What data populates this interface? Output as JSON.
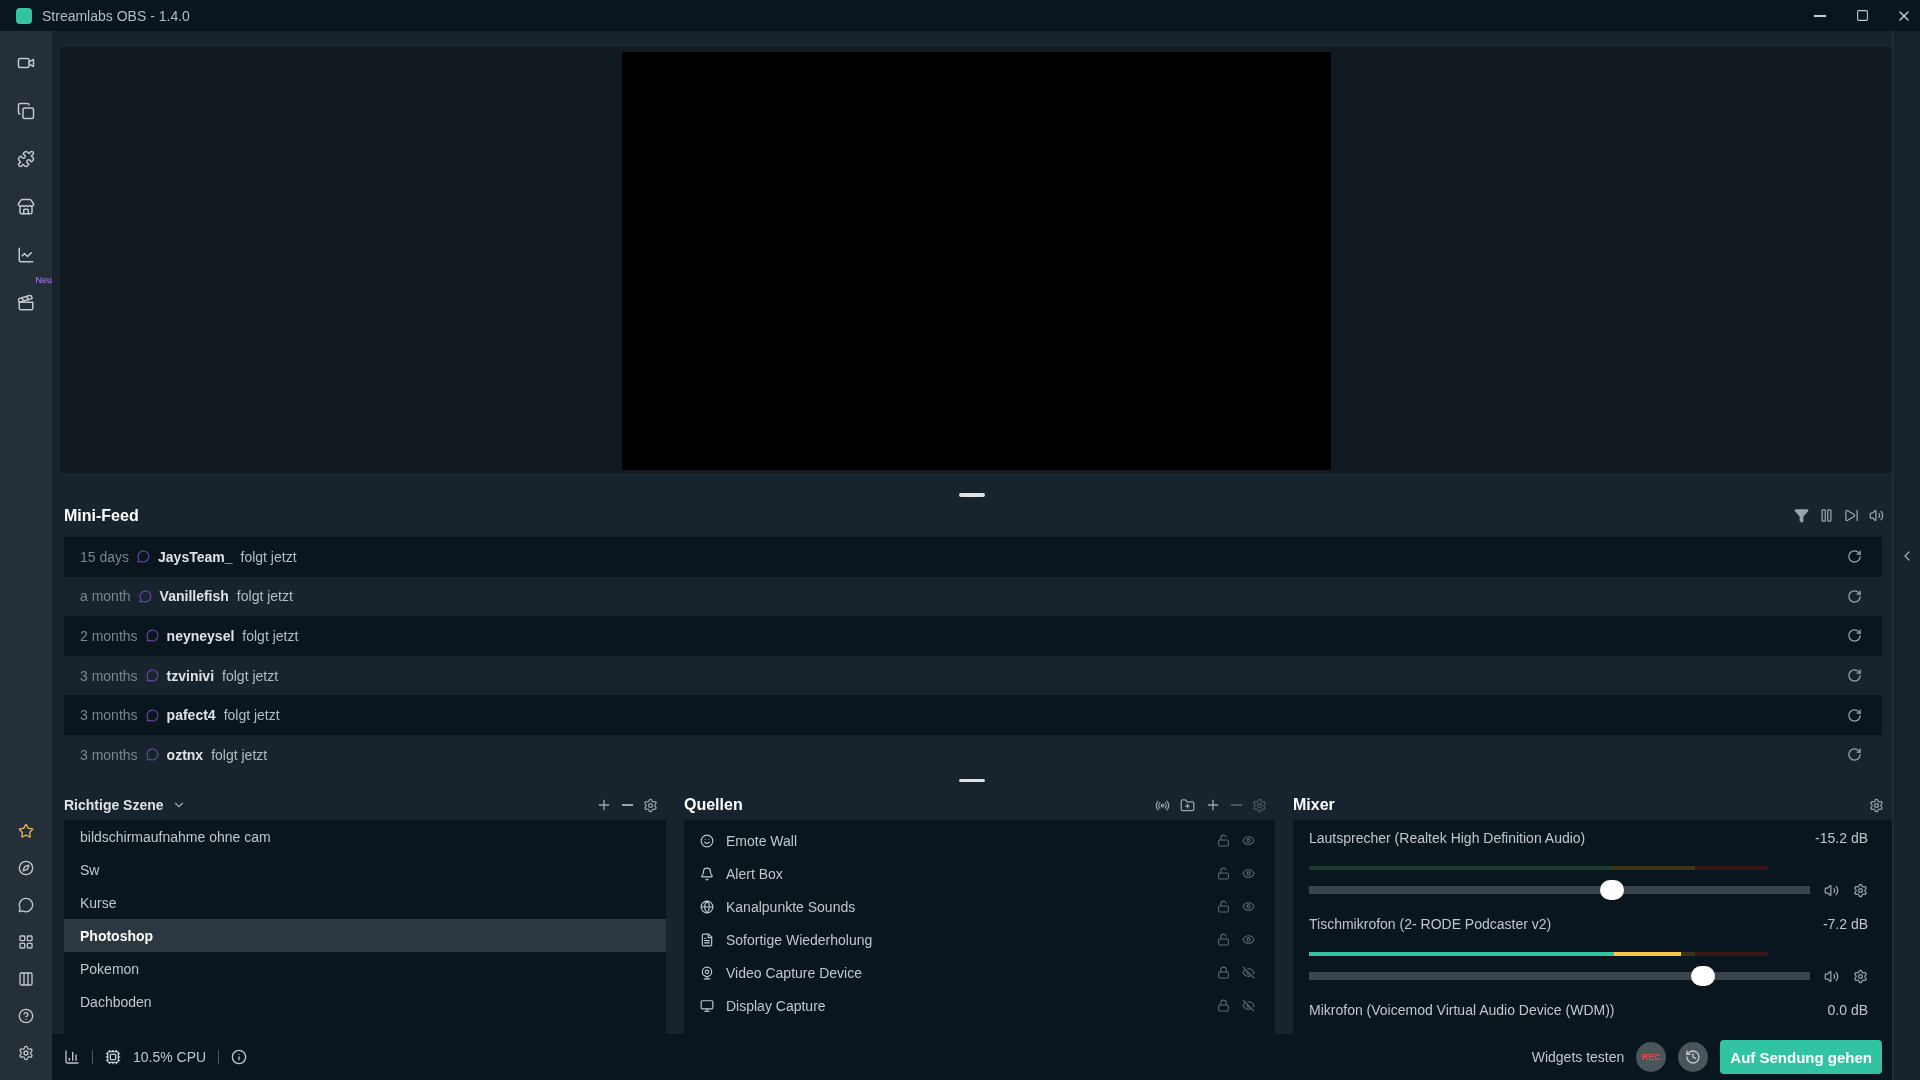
{
  "window": {
    "title": "Streamlabs OBS - 1.4.0"
  },
  "nav": {
    "badge": "Neu"
  },
  "mini_feed": {
    "title": "Mini-Feed",
    "events": [
      {
        "time": "15 days",
        "name": "JaysTeam_",
        "action": "folgt jetzt"
      },
      {
        "time": "a month",
        "name": "Vanillefish",
        "action": "folgt jetzt"
      },
      {
        "time": "2 months",
        "name": "neyneysel",
        "action": "folgt jetzt"
      },
      {
        "time": "3 months",
        "name": "tzvinivi",
        "action": "folgt jetzt"
      },
      {
        "time": "3 months",
        "name": "pafect4",
        "action": "folgt jetzt"
      },
      {
        "time": "3 months",
        "name": "oztnx",
        "action": "folgt jetzt"
      }
    ]
  },
  "scenes": {
    "title": "Richtige Szene",
    "items": [
      {
        "name": "bildschirmaufnahme ohne cam",
        "selected": false
      },
      {
        "name": "Sw",
        "selected": false
      },
      {
        "name": "Kurse",
        "selected": false
      },
      {
        "name": "Photoshop",
        "selected": true
      },
      {
        "name": "Pokemon",
        "selected": false
      },
      {
        "name": "Dachboden",
        "selected": false
      }
    ]
  },
  "sources": {
    "title": "Quellen",
    "items": [
      {
        "name": "Emote Wall",
        "kind": "emote",
        "locked": false,
        "visible": true
      },
      {
        "name": "Alert Box",
        "kind": "alert",
        "locked": false,
        "visible": true
      },
      {
        "name": "Kanalpunkte Sounds",
        "kind": "web",
        "locked": false,
        "visible": true
      },
      {
        "name": "Sofortige Wiederholung",
        "kind": "file",
        "locked": false,
        "visible": true
      },
      {
        "name": "Video Capture Device",
        "kind": "camera",
        "locked": true,
        "visible": false
      },
      {
        "name": "Display Capture",
        "kind": "display",
        "locked": true,
        "visible": false
      }
    ]
  },
  "mixer": {
    "title": "Mixer",
    "channels": [
      {
        "name": "Lautsprecher (Realtek High Definition Audio)",
        "reading": "-15.2 dB",
        "meter": {
          "level": 0
        },
        "volume": {
          "level": 0.61
        }
      },
      {
        "name": "Tischmikrofon (2- RODE Podcaster v2)",
        "reading": "-7.2 dB",
        "meter": {
          "level": 0.81
        },
        "volume": {
          "level": 0.8
        }
      },
      {
        "name": "Mikrofon (Voicemod Virtual Audio Device (WDM))",
        "reading": "0.0 dB"
      }
    ]
  },
  "status_bar": {
    "cpu": "10.5% CPU",
    "test_widgets": "Widgets testen",
    "rec": "REC",
    "go_live": "Auf Sendung gehen"
  }
}
